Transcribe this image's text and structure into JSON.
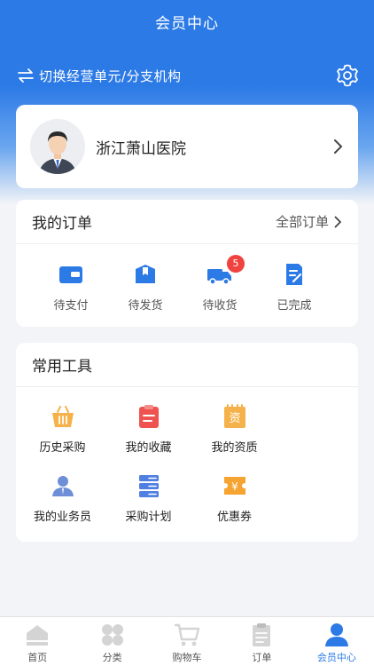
{
  "header": {
    "title": "会员中心",
    "switch_label": "切换经营单元/分支机构"
  },
  "profile": {
    "name": "浙江萧山医院"
  },
  "orders": {
    "title": "我的订单",
    "all_label": "全部订单",
    "items": [
      {
        "label": "待支付",
        "icon": "wallet-icon"
      },
      {
        "label": "待发货",
        "icon": "package-icon"
      },
      {
        "label": "待收货",
        "icon": "truck-icon",
        "badge": "5"
      },
      {
        "label": "已完成",
        "icon": "completed-doc-icon"
      }
    ]
  },
  "tools": {
    "title": "常用工具",
    "items": [
      {
        "label": "历史采购",
        "icon": "basket-icon"
      },
      {
        "label": "我的收藏",
        "icon": "favorites-clipboard-icon"
      },
      {
        "label": "我的资质",
        "icon": "qualification-icon"
      },
      {
        "label": "我的业务员",
        "icon": "salesperson-icon"
      },
      {
        "label": "采购计划",
        "icon": "plan-list-icon"
      },
      {
        "label": "优惠券",
        "icon": "coupon-icon"
      }
    ]
  },
  "tabbar": {
    "items": [
      {
        "label": "首页",
        "icon": "home-icon"
      },
      {
        "label": "分类",
        "icon": "category-icon"
      },
      {
        "label": "购物车",
        "icon": "cart-icon"
      },
      {
        "label": "订单",
        "icon": "orders-icon"
      },
      {
        "label": "会员中心",
        "icon": "member-icon"
      }
    ],
    "active_index": 4
  },
  "colors": {
    "primary": "#2c7ae6",
    "badge": "#f0433f",
    "background": "#f3f4f7"
  }
}
